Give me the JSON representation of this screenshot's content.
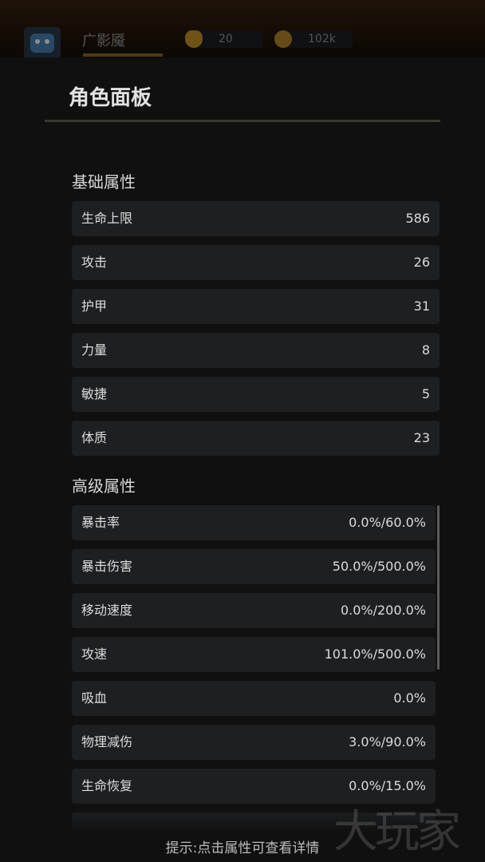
{
  "topbar": {
    "player_name": "广影魇",
    "gold": "20",
    "coins": "102k"
  },
  "panel": {
    "title": "角色面板",
    "basic_title": "基础属性",
    "basic": [
      {
        "label": "生命上限",
        "value": "586"
      },
      {
        "label": "攻击",
        "value": "26"
      },
      {
        "label": "护甲",
        "value": "31"
      },
      {
        "label": "力量",
        "value": "8"
      },
      {
        "label": "敏捷",
        "value": "5"
      },
      {
        "label": "体质",
        "value": "23"
      }
    ],
    "advanced_title": "高级属性",
    "advanced": [
      {
        "label": "暴击率",
        "value": "0.0%/60.0%"
      },
      {
        "label": "暴击伤害",
        "value": "50.0%/500.0%"
      },
      {
        "label": "移动速度",
        "value": "0.0%/200.0%"
      },
      {
        "label": "攻速",
        "value": "101.0%/500.0%"
      },
      {
        "label": "吸血",
        "value": "0.0%"
      },
      {
        "label": "物理减伤",
        "value": "3.0%/90.0%"
      },
      {
        "label": "生命恢复",
        "value": "0.0%/15.0%"
      }
    ],
    "tip": "提示:点击属性可查看详情"
  },
  "watermark": "大玩家",
  "colors": {
    "background": "#101010",
    "row": "#1d1f21",
    "accent": "#8a6a22"
  }
}
